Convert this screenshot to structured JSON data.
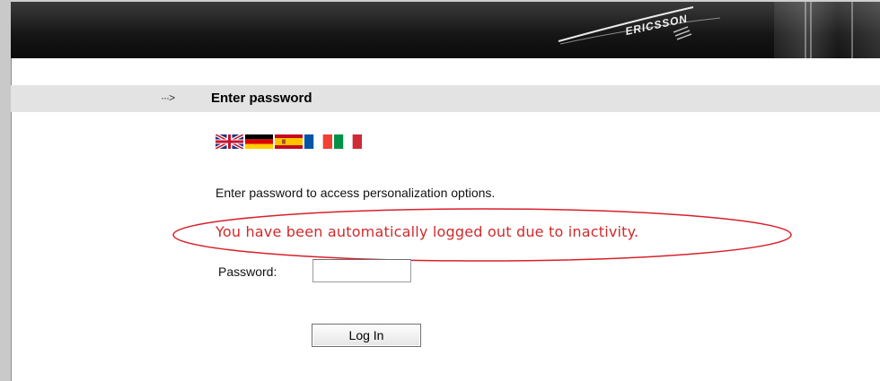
{
  "header": {
    "logo_text": "ERICSSON"
  },
  "titlebar": {
    "arrow_icon": "dotted-arrow-icon",
    "title": "Enter password"
  },
  "languages": [
    {
      "icon": "flag-uk-icon"
    },
    {
      "icon": "flag-germany-icon"
    },
    {
      "icon": "flag-spain-icon"
    },
    {
      "icon": "flag-france-icon"
    },
    {
      "icon": "flag-italy-icon"
    }
  ],
  "content": {
    "instruction": "Enter password to access personalization options.",
    "logout_message": "You have been automatically logged out due to inactivity.",
    "logout_color": "#d12a2a",
    "password_label": "Password:",
    "password_value": "",
    "login_button": "Log In"
  }
}
